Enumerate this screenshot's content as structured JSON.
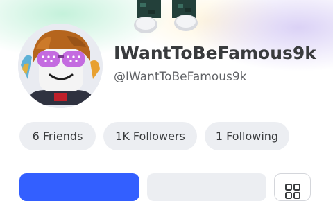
{
  "profile": {
    "display_name": "IWantToBeFamous9k",
    "username": "@IWantToBeFamous9k"
  },
  "stats": {
    "friends": "6 Friends",
    "followers": "1K Followers",
    "following": "1 Following"
  },
  "icons": {
    "more": "grid-icon"
  },
  "colors": {
    "primary_button": "#335fff",
    "pill_background": "#eceef2",
    "name_text": "#393b3d"
  }
}
